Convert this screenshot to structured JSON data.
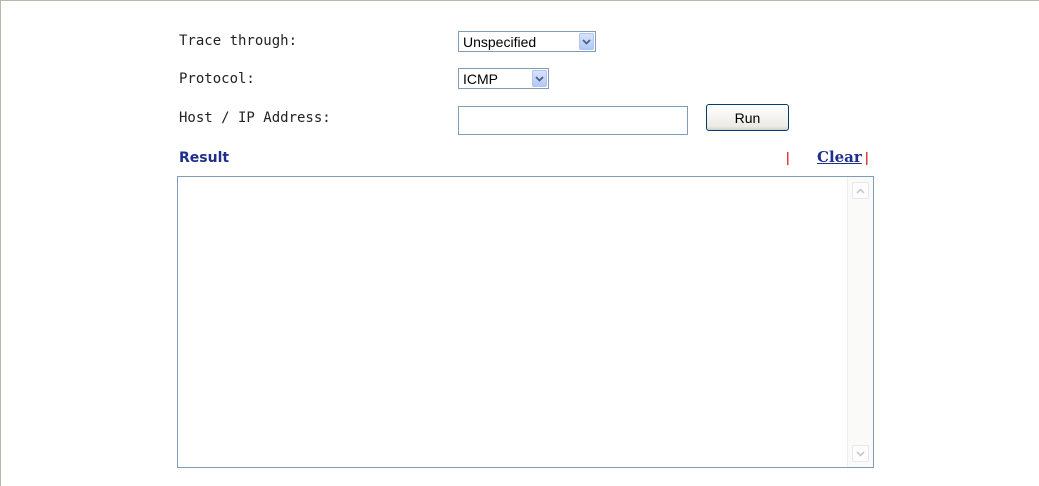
{
  "form": {
    "trace_label": "Trace through:",
    "trace_value": "Unspecified",
    "protocol_label": "Protocol:",
    "protocol_value": "ICMP",
    "host_label": "Host / IP Address:",
    "host_value": "",
    "run_label": "Run"
  },
  "result": {
    "title": "Result",
    "separator": "|",
    "clear_label": "Clear",
    "content": ""
  },
  "icons": {
    "dropdown": "chevron-down-icon",
    "scroll_up": "arrow-up-icon",
    "scroll_down": "arrow-down-icon"
  },
  "colors": {
    "link": "#1e2f8c",
    "separator": "#d10000",
    "field_border": "#7f9db9"
  }
}
